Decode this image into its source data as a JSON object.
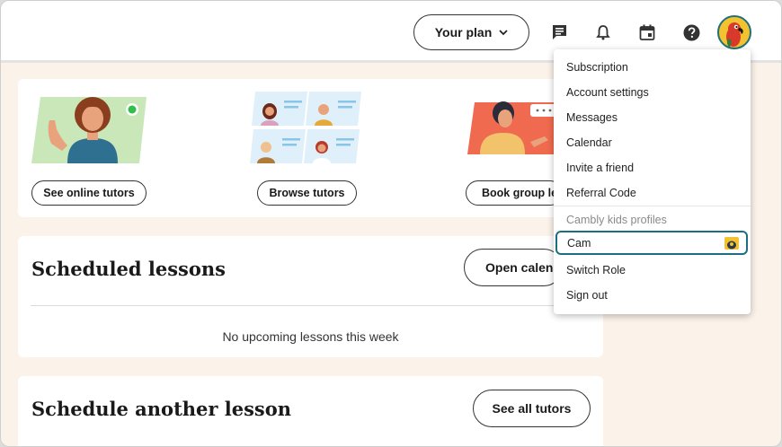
{
  "header": {
    "plan_label": "Your plan",
    "icons": [
      "messages-icon",
      "bell-icon",
      "calendar-icon",
      "help-icon"
    ]
  },
  "quick_actions": [
    {
      "label": "See online tutors"
    },
    {
      "label": "Browse tutors"
    },
    {
      "label": "Book group lessons"
    }
  ],
  "scheduled": {
    "title": "Scheduled lessons",
    "open_calendar_label": "Open calendar",
    "empty_text": "No upcoming lessons this week"
  },
  "schedule_another": {
    "title": "Schedule another lesson",
    "see_all_label": "See all tutors"
  },
  "menu": {
    "items": [
      {
        "label": "Subscription"
      },
      {
        "label": "Account settings"
      },
      {
        "label": "Messages"
      },
      {
        "label": "Calendar"
      },
      {
        "label": "Invite a friend"
      },
      {
        "label": "Referral Code"
      }
    ],
    "kids_header": "Cambly kids profiles",
    "kid_profile": "Cam",
    "switch_role": "Switch Role",
    "sign_out": "Sign out"
  },
  "colors": {
    "page_bg": "#fbf2e9",
    "accent_teal": "#1c6f80",
    "online_dot": "#2fbf4a",
    "avatar_bg": "#f2c230"
  }
}
